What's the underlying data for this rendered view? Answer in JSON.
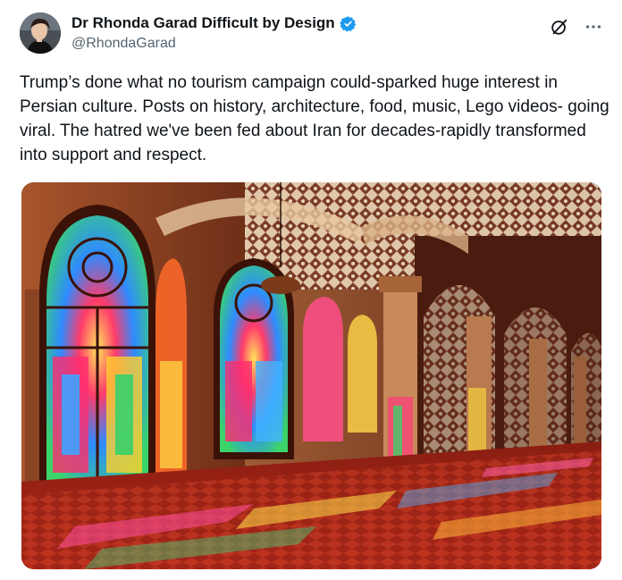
{
  "post": {
    "author": {
      "display_name": "Dr Rhonda Garad Difficult by Design",
      "handle": "@RhondaGarad",
      "verified": true
    },
    "text": "Trump’s done what no tourism campaign could-sparked huge interest in Persian culture. Posts on history, architecture, food, music, Lego videos- going viral. The hatred we've been fed about Iran for decades-rapidly transformed into support and respect.",
    "icons": {
      "verified": "verified-badge-icon",
      "grok": "grok-icon",
      "more": "more-options-icon"
    },
    "colors": {
      "accent": "#1d9bf0",
      "text": "#0f1419",
      "secondary": "#536471"
    }
  }
}
